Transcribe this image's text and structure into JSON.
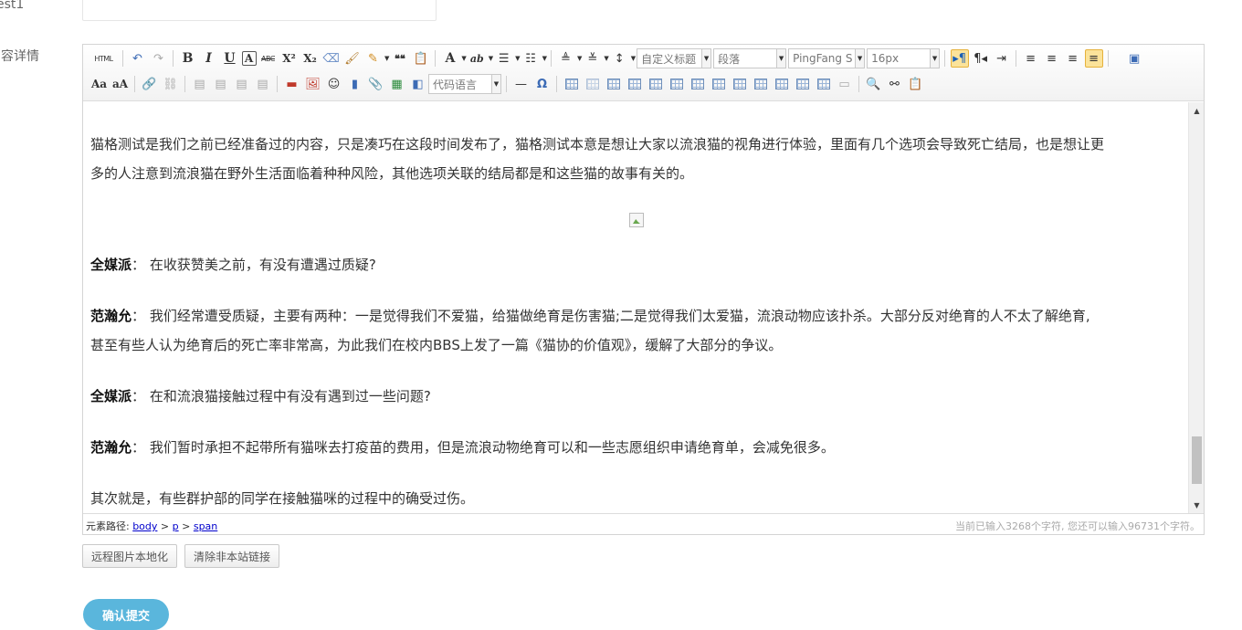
{
  "form": {
    "title_label_fragment": "est1",
    "content_label_fragment": "内容详情"
  },
  "toolbar": {
    "row1": {
      "html": "HTML",
      "bold": "B",
      "italic": "I",
      "underline": "U",
      "fontborder": "A",
      "strike": "ABC",
      "superscript": "X²",
      "subscript": "X₂",
      "quote": "❝❝",
      "forecolor": "A",
      "backcolor": "ab",
      "heading_select": "自定义标题",
      "paragraph_select": "段落",
      "font_select": "PingFang S",
      "size_select": "16px"
    },
    "row2": {
      "code_select": "代码语言",
      "horizontal": "—",
      "special_char": "Ω"
    }
  },
  "content": {
    "intro_line1": "猫格测试是我们之前已经准备过的内容，只是凑巧在这段时间发布了，猫格测试本意是想让大家以流浪猫的视角进行体验，里面有几个选项会导致死亡结局，也是想让更",
    "intro_line2": "多的人注意到流浪猫在野外生活面临着种种风险，其他选项关联的结局都是和这些猫的故事有关的。",
    "qa": [
      {
        "speaker": "全媒派",
        "sep": "：",
        "text": "在收获赞美之前，有没有遭遇过质疑?"
      },
      {
        "speaker": "范瀚允",
        "sep": "：",
        "text": "我们经常遭受质疑，主要有两种：一是觉得我们不爱猫，给猫做绝育是伤害猫;二是觉得我们太爱猫，流浪动物应该扑杀。大部分反对绝育的人不太了解绝育,",
        "text2": "甚至有些人认为绝育后的死亡率非常高，为此我们在校内BBS上发了一篇《猫协的价值观》，缓解了大部分的争议。"
      },
      {
        "speaker": "全媒派",
        "sep": "：",
        "text": "在和流浪猫接触过程中有没有遇到过一些问题?"
      },
      {
        "speaker": "范瀚允",
        "sep": "：",
        "text": "我们暂时承担不起带所有猫咪去打疫苗的费用，但是流浪动物绝育可以和一些志愿组织申请绝育单，会减免很多。"
      }
    ],
    "last_line": "其次就是，有些群护部的同学在接触猫咪的过程中的确受过伤。"
  },
  "statusbar": {
    "path_label": "元素路径: ",
    "path_body": "body",
    "path_sep1": " > ",
    "path_p": "p",
    "path_sep2": " > ",
    "path_span": "span",
    "word_count": "当前已输入3268个字符, 您还可以输入96731个字符。"
  },
  "buttons": {
    "localize_images": "远程图片本地化",
    "clear_links": "清除非本站链接",
    "submit": "确认提交"
  },
  "colors": {
    "submit_bg": "#5ab6dc",
    "active_button": "#fbe39a"
  }
}
